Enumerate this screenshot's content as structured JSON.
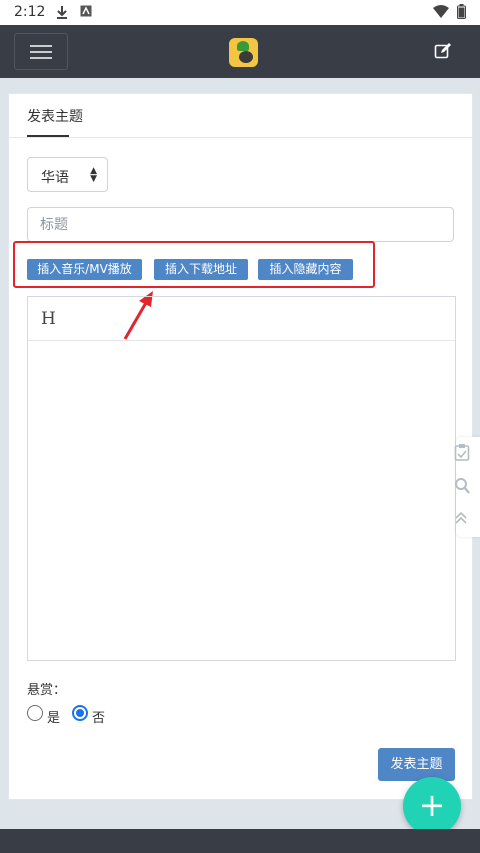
{
  "status_bar": {
    "time": "2:12",
    "icons": [
      "download-icon",
      "a-icon",
      "wifi-icon",
      "battery-icon"
    ]
  },
  "navbar": {
    "menu_icon": "hamburger-icon",
    "logo_icon": "app-logo-icon",
    "edit_icon": "edit-icon"
  },
  "form": {
    "tab_label": "发表主题",
    "category": {
      "selected": "华语"
    },
    "title": {
      "placeholder": "标题",
      "value": ""
    },
    "insert_buttons": [
      "插入音乐/MV播放",
      "插入下载地址",
      "插入隐藏内容"
    ],
    "editor": {
      "heading_button": "H"
    },
    "reward": {
      "label": "悬赏：",
      "options": [
        {
          "label": "是",
          "selected": false
        },
        {
          "label": "否",
          "selected": true
        }
      ]
    },
    "submit_label": "发表主题"
  },
  "side_tools": [
    "clipboard-icon",
    "search-icon",
    "double-chevron-up-icon"
  ],
  "fab": {
    "label": "+"
  },
  "colors": {
    "navbar": "#393e46",
    "primary_button": "#4f86c6",
    "highlight": "#e3242b",
    "fab": "#20d3b5",
    "radio_selected": "#1a73e8"
  }
}
